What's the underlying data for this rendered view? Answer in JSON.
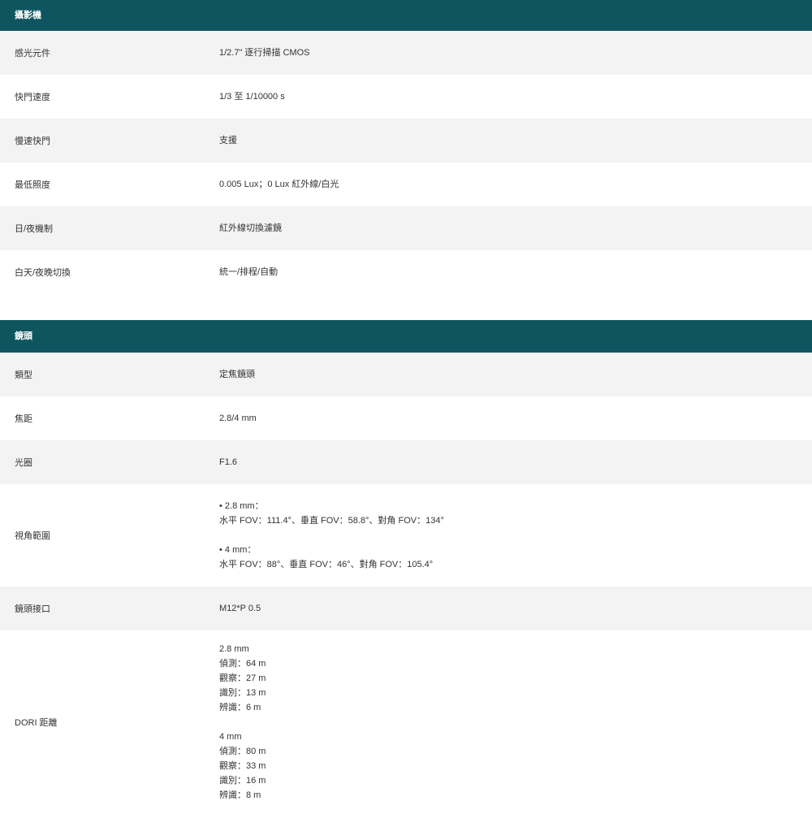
{
  "sections": [
    {
      "title": "攝影機",
      "rows": [
        {
          "label": "感光元件",
          "value": "1/2.7\" 逐行掃描 CMOS"
        },
        {
          "label": "快門速度",
          "value": "1/3 至 1/10000 s"
        },
        {
          "label": "慢速快門",
          "value": "支援"
        },
        {
          "label": "最低照度",
          "value": "0.005 Lux；0 Lux 紅外線/白光"
        },
        {
          "label": "日/夜機制",
          "value": "紅外線切換濾鏡"
        },
        {
          "label": "白天/夜晚切換",
          "value": "統一/排程/自動"
        }
      ]
    },
    {
      "title": "鏡頭",
      "rows": [
        {
          "label": "類型",
          "value": "定焦鏡頭"
        },
        {
          "label": "焦距",
          "value": "2.8/4 mm"
        },
        {
          "label": "光圈",
          "value": "F1.6"
        },
        {
          "label": "視角範圍",
          "fov": {
            "a_title": "• 2.8 mm：",
            "a_detail": "水平 FOV：111.4°、垂直 FOV：58.8°、對角 FOV：134°",
            "b_title": "• 4 mm：",
            "b_detail": "水平 FOV：88°、垂直 FOV：46°、對角 FOV：105.4°"
          }
        },
        {
          "label": "鏡頭接口",
          "value": "M12*P 0.5"
        },
        {
          "label": "DORI 距離",
          "dori": {
            "a": [
              "2.8 mm",
              "偵測：64 m",
              "觀察：27 m",
              "識別：13 m",
              "辨識：6 m"
            ],
            "b": [
              "4 mm",
              "偵測：80 m",
              "觀察：33 m",
              "識別：16 m",
              "辨識：8 m"
            ]
          }
        }
      ]
    }
  ]
}
